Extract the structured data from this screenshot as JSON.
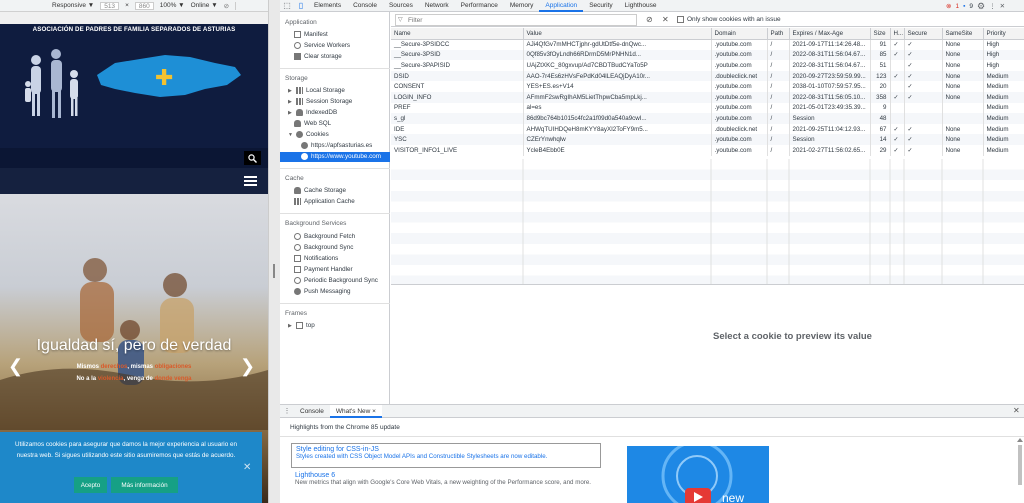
{
  "device_toolbar": {
    "mode": "Responsive ▼",
    "width": "513",
    "times": "×",
    "height": "860",
    "zoom": "100% ▼",
    "network": "Online ▼"
  },
  "site": {
    "title": "ASOCIACIÓN DE PADRES DE FAMILIA SEPARADOS DE ASTURIAS",
    "social": [
      "f",
      "t",
      "▶"
    ],
    "hero_title": "Igualdad sí, pero de verdad",
    "hero_sub1_a": "Mismos ",
    "hero_sub1_b": "derechos",
    "hero_sub1_c": ", mismas ",
    "hero_sub1_d": "obligaciones",
    "hero_sub2_a": "No a la ",
    "hero_sub2_b": "violencia",
    "hero_sub2_c": ", venga de ",
    "hero_sub2_d": "donde venga",
    "cookie_text": "Utilizamos cookies para asegurar que damos la mejor experiencia al usuario en nuestra web. Si sigues utilizando este sitio asumiremos que estás de acuerdo.",
    "accept": "Acepto",
    "more_info": "Más información",
    "close": "✕"
  },
  "devtools": {
    "tabs": [
      "Elements",
      "Console",
      "Sources",
      "Network",
      "Performance",
      "Memory",
      "Application",
      "Security",
      "Lighthouse"
    ],
    "active_tab": "Application",
    "errors": "1",
    "warnings": "9",
    "sidebar": {
      "application_head": "Application",
      "application_items": [
        "Manifest",
        "Service Workers",
        "Clear storage"
      ],
      "storage_head": "Storage",
      "storage_items": [
        "Local Storage",
        "Session Storage",
        "IndexedDB",
        "Web SQL",
        "Cookies"
      ],
      "cookie_sites": [
        "https://apfsasturias.es",
        "https://www.youtube.com"
      ],
      "cache_head": "Cache",
      "cache_items": [
        "Cache Storage",
        "Application Cache"
      ],
      "bg_head": "Background Services",
      "bg_items": [
        "Background Fetch",
        "Background Sync",
        "Notifications",
        "Payment Handler",
        "Periodic Background Sync",
        "Push Messaging"
      ],
      "frames_head": "Frames",
      "frames_items": [
        "top"
      ]
    },
    "filter_placeholder": "Filter",
    "issue_label": "Only show cookies with an issue",
    "columns": [
      "Name",
      "Value",
      "Domain",
      "Path",
      "Expires / Max-Age",
      "Size",
      "H...",
      "Secure",
      "SameSite",
      "Priority"
    ],
    "rows": [
      [
        "__Secure-3PSIDCC",
        "AJi4QfGv7mMHCTjphr-gdUtDtf5e-dnQwc...",
        ".youtube.com",
        "/",
        "2021-09-17T11:14:26.48...",
        "91",
        "✓",
        "✓",
        "None",
        "High"
      ],
      [
        "__Secure-3PSID",
        "0Qf85v3fOyLndh66RDrmD5MrPNHN1d...",
        ".youtube.com",
        "/",
        "2022-08-31T11:56:04.67...",
        "85",
        "✓",
        "✓",
        "None",
        "High"
      ],
      [
        "__Secure-3PAPISID",
        "UAjZtXKC_80gxvup/Ad7CBDTBudCYaTo5P",
        ".youtube.com",
        "/",
        "2022-08-31T11:56:04.67...",
        "51",
        "",
        "✓",
        "None",
        "High"
      ],
      [
        "DSID",
        "AAO-7r4Es6zHVsFePdKd04lLEAQjDyA10r...",
        ".doubleclick.net",
        "/",
        "2020-09-27T23:59:59.99...",
        "123",
        "✓",
        "✓",
        "None",
        "Medium"
      ],
      [
        "CONSENT",
        "YES+ES.es+V14",
        ".youtube.com",
        "/",
        "2038-01-10T07:59:57.95...",
        "20",
        "",
        "✓",
        "None",
        "Medium"
      ],
      [
        "LOGIN_INFO",
        "AFmmF2swRgIhAM5LietThpwCba5mpLkj...",
        ".youtube.com",
        "/",
        "2022-08-31T11:56:05.10...",
        "358",
        "✓",
        "✓",
        "None",
        "Medium"
      ],
      [
        "PREF",
        "al=es",
        ".youtube.com",
        "/",
        "2021-05-01T23:49:35.39...",
        "9",
        "",
        "",
        "",
        "Medium"
      ],
      [
        "s_gl",
        "86d9bc764b1015c4fc2a1f09d0a540a9cwI...",
        ".youtube.com",
        "/",
        "Session",
        "48",
        "",
        "",
        "",
        "Medium"
      ],
      [
        "IDE",
        "AHWqTUIHDQeH8mKYY8ayXI2ToFY9m5...",
        ".doubleclick.net",
        "/",
        "2021-09-25T11:04:12.93...",
        "67",
        "✓",
        "✓",
        "None",
        "Medium"
      ],
      [
        "YSC",
        "CZErYnwhqlw",
        ".youtube.com",
        "/",
        "Session",
        "14",
        "✓",
        "✓",
        "None",
        "Medium"
      ],
      [
        "VISITOR_INFO1_LIVE",
        "YcleB4Ebb0E",
        ".youtube.com",
        "/",
        "2021-02-27T11:56:02.65...",
        "29",
        "✓",
        "✓",
        "None",
        "Medium"
      ]
    ],
    "preview_text": "Select a cookie to preview its value",
    "drawer": {
      "tabs": [
        "Console",
        "What's New"
      ],
      "close_tab": "×",
      "highlights": "Highlights from the Chrome 85 update",
      "card1_title": "Style editing for CSS-in-JS",
      "card1_desc": "Styles created with CSS Object Model APIs and Constructible Stylesheets are now editable.",
      "card2_title": "Lighthouse 6",
      "card2_desc": "New metrics that align with Google's Core Web Vitals, a new weighting of the Performance score, and more.",
      "video_text": "new"
    }
  }
}
